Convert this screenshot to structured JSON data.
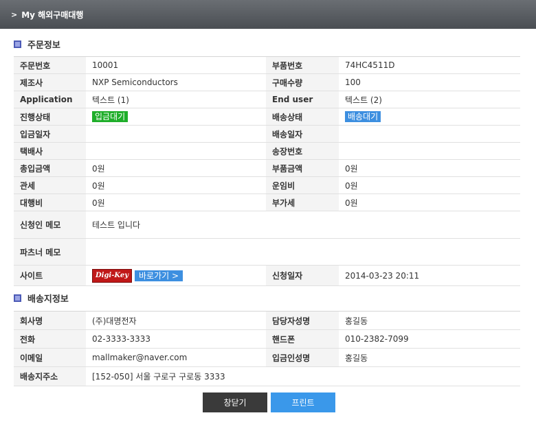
{
  "header": {
    "title": "My 해외구매대행"
  },
  "order_section": {
    "title": "주문정보"
  },
  "order": {
    "order_no_label": "주문번호",
    "order_no": "10001",
    "part_no_label": "부품번호",
    "part_no": "74HC4511D",
    "maker_label": "제조사",
    "maker": "NXP Semiconductors",
    "qty_label": "구매수량",
    "qty": "100",
    "application_label": "Application",
    "application": "텍스트 (1)",
    "enduser_label": "End user",
    "enduser": "텍스트 (2)",
    "progress_label": "진행상태",
    "progress": "입금대기",
    "delivery_status_label": "배송상태",
    "delivery_status": "배송대기",
    "deposit_date_label": "입금일자",
    "deposit_date": "",
    "delivery_date_label": "배송일자",
    "delivery_date": "",
    "courier_label": "택배사",
    "courier": "",
    "invoice_label": "송장번호",
    "invoice": "",
    "total_label": "총입금액",
    "total": "0원",
    "part_amount_label": "부품금액",
    "part_amount": "0원",
    "customs_label": "관세",
    "customs": "0원",
    "shipping_label": "운임비",
    "shipping": "0원",
    "agency_fee_label": "대행비",
    "agency_fee": "0원",
    "vat_label": "부가세",
    "vat": "0원",
    "applicant_memo_label": "신청인 메모",
    "applicant_memo": "테스트 입니다",
    "partner_memo_label": "파츠너 메모",
    "partner_memo": "",
    "site_label": "사이트",
    "site_logo": "Digi-Key",
    "goto_label": "바로가기 >",
    "request_date_label": "신청일자",
    "request_date": "2014-03-23 20:11"
  },
  "ship_section": {
    "title": "배송지정보"
  },
  "ship": {
    "company_label": "회사명",
    "company": "(주)대명전자",
    "manager_label": "담당자성명",
    "manager": "홍길동",
    "phone_label": "전화",
    "phone": "02-3333-3333",
    "mobile_label": "핸드폰",
    "mobile": "010-2382-7099",
    "email_label": "이메일",
    "email": "mallmaker@naver.com",
    "depositor_label": "입금인성명",
    "depositor": "홍길동",
    "address_label": "배송지주소",
    "address": "[152-050] 서울 구로구 구로동 3333"
  },
  "buttons": {
    "close": "창닫기",
    "print": "프린트"
  },
  "colors": {
    "status_green": "#1fae2a",
    "accent_blue": "#3d8fe0",
    "header_bg": "#55595e"
  }
}
